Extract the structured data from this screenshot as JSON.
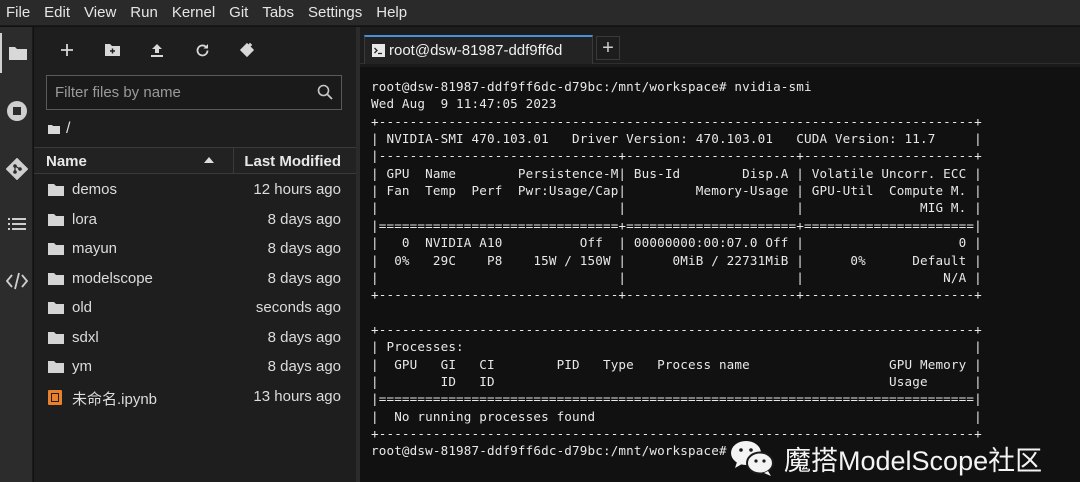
{
  "menubar": {
    "items": [
      "File",
      "Edit",
      "View",
      "Run",
      "Kernel",
      "Git",
      "Tabs",
      "Settings",
      "Help"
    ]
  },
  "activitybar": {
    "icons": [
      "folder-icon",
      "running-icon",
      "git-icon",
      "toc-icon",
      "extension-icon"
    ]
  },
  "filebrowser": {
    "filter_placeholder": "Filter files by name",
    "breadcrumb": "/",
    "columns": {
      "name": "Name",
      "modified": "Last Modified"
    },
    "files": [
      {
        "name": "demos",
        "modified": "12 hours ago",
        "type": "folder"
      },
      {
        "name": "lora",
        "modified": "8 days ago",
        "type": "folder"
      },
      {
        "name": "mayun",
        "modified": "8 days ago",
        "type": "folder"
      },
      {
        "name": "modelscope",
        "modified": "8 days ago",
        "type": "folder"
      },
      {
        "name": "old",
        "modified": "seconds ago",
        "type": "folder"
      },
      {
        "name": "sdxl",
        "modified": "8 days ago",
        "type": "folder"
      },
      {
        "name": "ym",
        "modified": "8 days ago",
        "type": "folder"
      },
      {
        "name": "未命名.ipynb",
        "modified": "13 hours ago",
        "type": "notebook"
      }
    ]
  },
  "main": {
    "tab_label": "root@dsw-81987-ddf9ff6d",
    "add_tab_label": "+"
  },
  "terminal": {
    "lines": [
      "root@dsw-81987-ddf9ff6dc-d79bc:/mnt/workspace# nvidia-smi",
      "Wed Aug  9 11:47:05 2023",
      "+-----------------------------------------------------------------------------+",
      "| NVIDIA-SMI 470.103.01   Driver Version: 470.103.01   CUDA Version: 11.7     |",
      "|-------------------------------+----------------------+----------------------+",
      "| GPU  Name        Persistence-M| Bus-Id        Disp.A | Volatile Uncorr. ECC |",
      "| Fan  Temp  Perf  Pwr:Usage/Cap|         Memory-Usage | GPU-Util  Compute M. |",
      "|                               |                      |               MIG M. |",
      "|===============================+======================+======================|",
      "|   0  NVIDIA A10          Off  | 00000000:00:07.0 Off |                    0 |",
      "|  0%   29C    P8    15W / 150W |      0MiB / 22731MiB |      0%      Default |",
      "|                               |                      |                  N/A |",
      "+-------------------------------+----------------------+----------------------+",
      "",
      "+-----------------------------------------------------------------------------+",
      "| Processes:                                                                  |",
      "|  GPU   GI   CI        PID   Type   Process name                  GPU Memory |",
      "|        ID   ID                                                   Usage      |",
      "|=============================================================================|",
      "|  No running processes found                                                 |",
      "+-----------------------------------------------------------------------------+",
      "root@dsw-81987-ddf9ff6dc-d79bc:/mnt/workspace#"
    ]
  },
  "watermark": {
    "text": "魔搭ModelScope社区"
  }
}
